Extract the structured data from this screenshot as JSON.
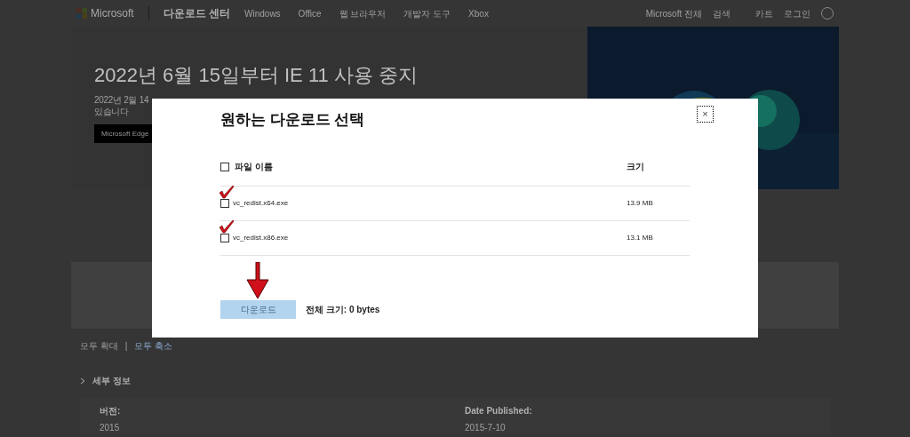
{
  "header": {
    "logo": "Microsoft",
    "site": "다운로드 센터",
    "nav": [
      "Windows",
      "Office",
      "웹 브라우저",
      "개발자 도구",
      "Xbox"
    ],
    "right": [
      "Microsoft 전체",
      "검색",
      "카트",
      "로그인"
    ]
  },
  "hero": {
    "title": "2022년 6월 15일부터 IE 11 사용 중지",
    "text_lines": [
      "2022년 2월 14",
      "있습니다"
    ],
    "button": "Microsoft Edge"
  },
  "expand_links": [
    "모두 확대",
    "모두 축소"
  ],
  "expand_separator": "|",
  "details": {
    "heading": "세부 정보",
    "expanded": false,
    "fields": [
      {
        "label": "버전:",
        "value": "2015"
      },
      {
        "label": "Date Published:",
        "value": "2015-7-10"
      }
    ]
  },
  "dialog": {
    "title": "원하는 다운로드 선택",
    "close": "×",
    "columns": [
      "파일 이름",
      "크기"
    ],
    "select_all": {
      "checked": false
    },
    "rows": [
      {
        "name": "vc_redist.x64.exe",
        "size": "13.9 MB",
        "checked": false,
        "annotated": true
      },
      {
        "name": "vc_redist.x86.exe",
        "size": "13.1 MB",
        "checked": false,
        "annotated": true
      }
    ],
    "download_button": {
      "label": "다운로드",
      "disabled": true,
      "annotated": true
    },
    "total": "전체 크기: 0 bytes"
  }
}
